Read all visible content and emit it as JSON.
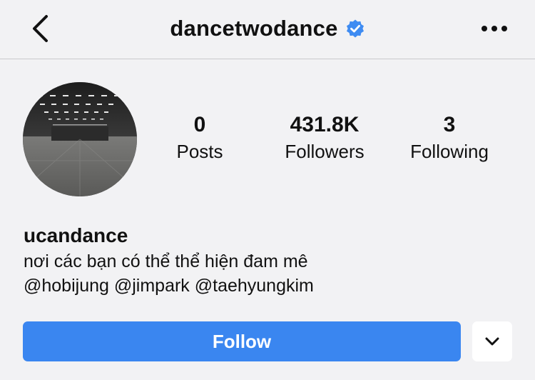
{
  "header": {
    "username": "dancetwodance",
    "verified_icon": "verified-badge-icon",
    "back_icon": "chevron-left-icon",
    "more_icon": "more-horizontal-icon"
  },
  "profile": {
    "avatar_icon": "avatar-image",
    "stats": [
      {
        "value": "0",
        "label": "Posts"
      },
      {
        "value": "431.8K",
        "label": "Followers"
      },
      {
        "value": "3",
        "label": "Following"
      }
    ]
  },
  "bio": {
    "name": "ucandance",
    "line1": "nơi các bạn có thể thể hiện đam mê",
    "line2": "@hobijung @jimpark @taehyungkim"
  },
  "actions": {
    "follow_label": "Follow",
    "dropdown_icon": "chevron-down-icon"
  },
  "colors": {
    "background": "#f2f2f4",
    "accent": "#3a86f0",
    "verified": "#3f8cf2"
  }
}
